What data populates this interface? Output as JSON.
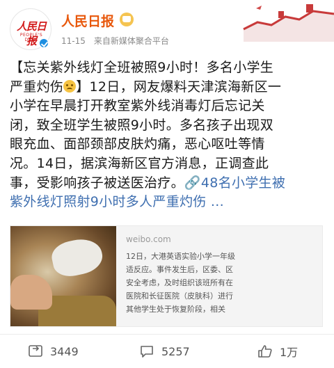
{
  "header": {
    "account_name": "人民日报",
    "avatar_logo_text": "人民日报",
    "avatar_logo_sub": "PEOPLE'S DAILY",
    "date": "11-15",
    "source": "来自新媒体聚合平台"
  },
  "post": {
    "line1": "【忘关紫外线灯全班被照9小时！多名小学生",
    "line2a": "严重灼伤",
    "line2b": "】12日，网友爆料天津滨海新区一",
    "line3": "小学在早晨打开教室紫外线消毒灯后忘记关",
    "line4": "闭，致全班学生被照9小时。多名孩子出现双",
    "line5": "眼充血、面部颈部皮肤灼痛，恶心呕吐等情",
    "line6": "况。14日，据滨海新区官方消息，正调查此",
    "line7a": "事，受影响孩子被送医治疗。",
    "link_icon": "🔗",
    "line7b": "48名小学生被",
    "line8": "紫外线灯照射9小时多人严重灼伤 ..."
  },
  "card": {
    "source": "weibo.com",
    "text_lines": [
      "12日，大港英语实验小学一年级",
      "适反应。事件发生后，区委、区",
      "安全考虑，及时组织该班所有在",
      "医院和长征医院（皮肤科）进行",
      "其他学生处于恢复阶段，相关"
    ]
  },
  "actions": {
    "repost_count": "3449",
    "comment_count": "5257",
    "like_count": "1万"
  },
  "colors": {
    "account_name": "#e8580c",
    "link": "#3f6fb0",
    "verified": "#1e8fe1"
  }
}
